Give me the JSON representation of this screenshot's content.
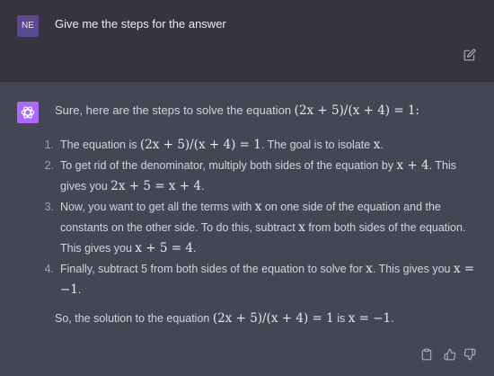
{
  "user": {
    "avatar_initials": "NE",
    "message": "Give me the steps for the answer"
  },
  "assistant": {
    "intro": "Sure, here are the steps to solve the equation ",
    "intro_math": "(2x + 5)/(x + 4) = 1:",
    "steps": [
      {
        "number": "1.",
        "parts": [
          {
            "t": "The equation is "
          },
          {
            "m": "(2x + 5)/(x + 4) = 1"
          },
          {
            "t": ". The goal is to isolate "
          },
          {
            "m": "x"
          },
          {
            "t": "."
          }
        ]
      },
      {
        "number": "2.",
        "parts": [
          {
            "t": "To get rid of the denominator, multiply both sides of the equation by "
          },
          {
            "m": "x + 4"
          },
          {
            "t": ". This gives you "
          },
          {
            "m": "2x + 5 = x + 4"
          },
          {
            "t": "."
          }
        ]
      },
      {
        "number": "3.",
        "parts": [
          {
            "t": "Now, you want to get all the terms with "
          },
          {
            "m": "x"
          },
          {
            "t": " on one side of the equation and the constants on the other side. To do this, subtract "
          },
          {
            "m": "x"
          },
          {
            "t": " from both sides of the equation. This gives you "
          },
          {
            "m": "x + 5 = 4"
          },
          {
            "t": "."
          }
        ]
      },
      {
        "number": "4.",
        "parts": [
          {
            "t": "Finally, subtract 5 from both sides of the equation to solve for "
          },
          {
            "m": "x"
          },
          {
            "t": ". This gives you "
          },
          {
            "m": "x = −1"
          },
          {
            "t": "."
          }
        ]
      }
    ],
    "conclusion_parts": [
      {
        "t": "So, the solution to the equation "
      },
      {
        "m": "(2x + 5)/(x + 4) = 1"
      },
      {
        "t": " is "
      },
      {
        "m": "x = −1"
      },
      {
        "t": "."
      }
    ]
  },
  "icons": {
    "edit": "pencil-edit-icon",
    "copy": "clipboard-copy-icon",
    "like": "thumbs-up-icon",
    "dislike": "thumbs-down-icon",
    "assistant_logo": "chatgpt-logo-icon"
  },
  "colors": {
    "user_bg": "#343541",
    "assistant_bg": "#444654",
    "user_avatar": "#5b4a8f",
    "assistant_avatar": "#ab68ff"
  }
}
